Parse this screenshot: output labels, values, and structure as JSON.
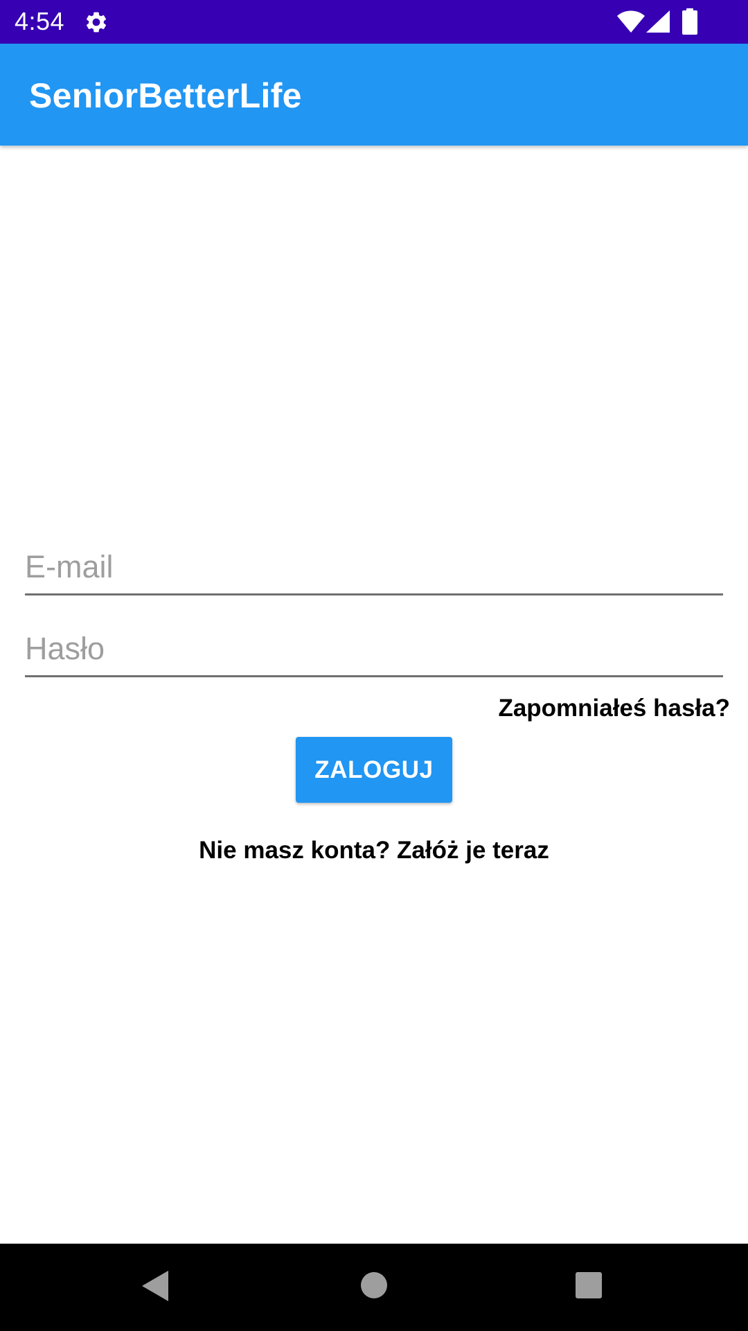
{
  "status_bar": {
    "time": "4:54",
    "icons": [
      "settings-gear-icon",
      "wifi-icon",
      "cell-signal-icon",
      "battery-icon"
    ],
    "background_color": "#3700b3"
  },
  "app_bar": {
    "title": "SeniorBetterLife",
    "background_color": "#2196f3"
  },
  "login_form": {
    "email": {
      "value": "",
      "placeholder": "E-mail"
    },
    "password": {
      "value": "",
      "placeholder": "Hasło"
    },
    "forgot_password_label": "Zapomniałeś hasła?",
    "login_button_label": "ZALOGUJ",
    "register_label": "Nie masz konta? Załóż je teraz",
    "accent_color": "#2196f3"
  },
  "navigation_bar": {
    "icons": [
      "back-triangle-icon",
      "home-circle-icon",
      "recents-square-icon"
    ]
  }
}
